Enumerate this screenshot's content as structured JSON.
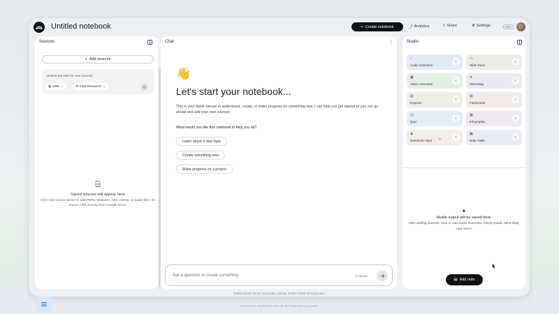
{
  "header": {
    "title": "Untitled notebook",
    "create_label": "Create notebook",
    "analytics_label": "Analytics",
    "share_label": "Share",
    "settings_label": "Settings",
    "pro_badge": "PRO"
  },
  "sources": {
    "title": "Sources",
    "add_label": "Add sources",
    "search_placeholder": "Search the web for new sources",
    "web_chip": "Web",
    "research_chip": "Fast Research",
    "empty_title": "Saved sources will appear here",
    "empty_desc": "Click Add source above to add PDFs, websites, text, videos, or audio files. Or import a file directly from Google Drive."
  },
  "chat": {
    "title": "Chat",
    "heading": "Let's start your notebook...",
    "intro": "This is your blank canvas to understand, create, or make progress on something new. I can help you get started or you can go ahead and add your own sources.",
    "question": "What would you like this notebook to help you do?",
    "suggestions": [
      "Learn about a new topic",
      "Create something new",
      "Make progress on a project"
    ],
    "input_placeholder": "Ask a question or create something",
    "source_count": "0 sources"
  },
  "studio": {
    "title": "Studio",
    "cards": [
      {
        "label": "Audio Overview",
        "icon": "audio-icon",
        "color": "#e3eaf5"
      },
      {
        "label": "Slide Deck",
        "icon": "slides-icon",
        "color": "#eeece8"
      },
      {
        "label": "Video Overview",
        "icon": "video-icon",
        "color": "#e2f1e6"
      },
      {
        "label": "Mind Map",
        "icon": "mindmap-icon",
        "color": "#ede9f2"
      },
      {
        "label": "Reports",
        "icon": "reports-icon",
        "color": "#efeee6"
      },
      {
        "label": "Flashcards",
        "icon": "flashcards-icon",
        "color": "#f3ebe8"
      },
      {
        "label": "Quiz",
        "icon": "quiz-icon",
        "color": "#e2eef5"
      },
      {
        "label": "Infographic",
        "icon": "infographic-icon",
        "color": "#eee8ef"
      },
      {
        "label": "Notebook Apps",
        "icon": "apps-icon",
        "color": "#f3ece8"
      },
      {
        "label": "Data Table",
        "icon": "table-icon",
        "color": "#e9ebf5"
      }
    ],
    "empty_title": "Studio output will be saved here.",
    "empty_desc": "After adding sources, click to add Audio Overview, Study Guide, Mind Map, and more!",
    "add_note_label": "Add note"
  },
  "disclaimer": "NotebookLM can be inaccurate; please double check its responses.",
  "footer_note": "Sequences shortened. Results for illustrative purposes."
}
